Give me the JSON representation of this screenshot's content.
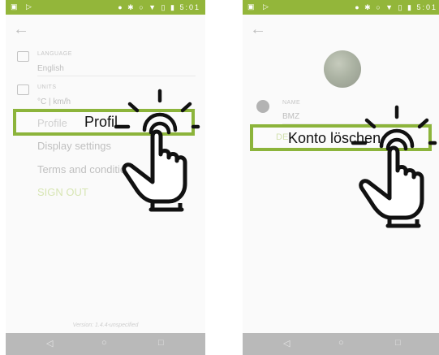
{
  "status_bar": {
    "left_icons": "▣ ▷",
    "right_icons": "● ✱ ○ ▼ ▯ ▮",
    "time": "5:01"
  },
  "left_screen": {
    "language_label": "LANGUAGE",
    "language_value": "English",
    "units_label": "UNITS",
    "units_value": "°C | km/h",
    "menu": {
      "profile": "Profile",
      "display_settings": "Display settings",
      "terms": "Terms and conditions",
      "sign_out": "SIGN OUT"
    },
    "version": "Version: 1.4.4-unspecified",
    "overlay_caption": "Profil"
  },
  "right_screen": {
    "name_label": "NAME",
    "name_value": "BMZ",
    "delete_partial": "DE",
    "overlay_caption": "Konto löschen"
  },
  "nav": {
    "back": "◁",
    "home": "○",
    "recent": "□"
  },
  "colors": {
    "accent": "#8cb43b",
    "status_bar": "#93b63a",
    "nav_bar": "#b9b9b9",
    "sign_out": "#c2d88a"
  }
}
